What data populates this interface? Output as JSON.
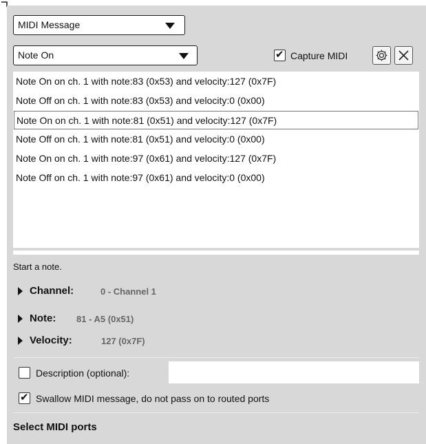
{
  "message_type": {
    "selected": "MIDI Message"
  },
  "event_type": {
    "selected": "Note On"
  },
  "capture": {
    "label": "Capture MIDI",
    "checked": true
  },
  "messages": [
    "Note On on ch. 1 with note:83 (0x53) and velocity:127 (0x7F)",
    "Note Off on ch. 1 with note:83 (0x53) and velocity:0 (0x00)",
    "Note On on ch. 1 with note:81 (0x51) and velocity:127 (0x7F)",
    "Note Off on ch. 1 with note:81 (0x51) and velocity:0 (0x00)",
    "Note On on ch. 1 with note:97 (0x61) and velocity:127 (0x7F)",
    "Note Off on ch. 1 with note:97 (0x61) and velocity:0 (0x00)"
  ],
  "selected_message_index": 2,
  "hint": "Start a note.",
  "properties": [
    {
      "label": "Channel:",
      "value": "0 - Channel 1"
    },
    {
      "label": "Note:",
      "value": "81 - A5 (0x51)"
    },
    {
      "label": "Velocity:",
      "value": "127 (0x7F)"
    }
  ],
  "description": {
    "label": "Description (optional):",
    "value": "",
    "checked": false
  },
  "swallow": {
    "label": "Swallow MIDI message, do not pass on to routed ports",
    "checked": true
  },
  "ports_heading": "Select MIDI ports",
  "icons": {
    "settings": "gear-icon",
    "close": "close-icon"
  }
}
